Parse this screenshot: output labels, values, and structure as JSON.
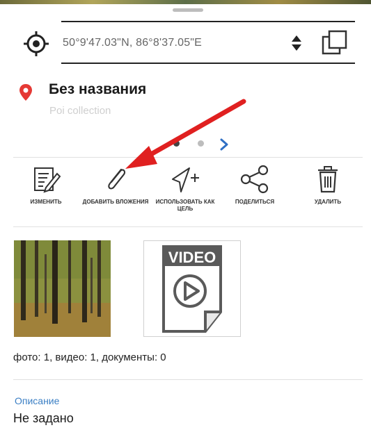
{
  "location": {
    "coordinates": "50°9'47.03\"N, 86°8'37.05\"E"
  },
  "poi": {
    "title": "Без названия",
    "subtitle": "Poi collection"
  },
  "actions": [
    {
      "label": "изменить",
      "icon": "edit-icon"
    },
    {
      "label": "добавить вложения",
      "icon": "paperclip-icon"
    },
    {
      "label": "использовать как цель",
      "icon": "navigate-plus-icon"
    },
    {
      "label": "поделиться",
      "icon": "share-icon"
    },
    {
      "label": "удалить",
      "icon": "trash-icon"
    }
  ],
  "attachments": {
    "video_label": "VIDEO",
    "counts": "фото: 1, видео: 1, документы: 0"
  },
  "description": {
    "label": "Описание",
    "value": "Не задано"
  },
  "colors": {
    "accent_blue": "#3b7fc4",
    "pin_red": "#e53935",
    "annotation_arrow": "#e02020"
  }
}
